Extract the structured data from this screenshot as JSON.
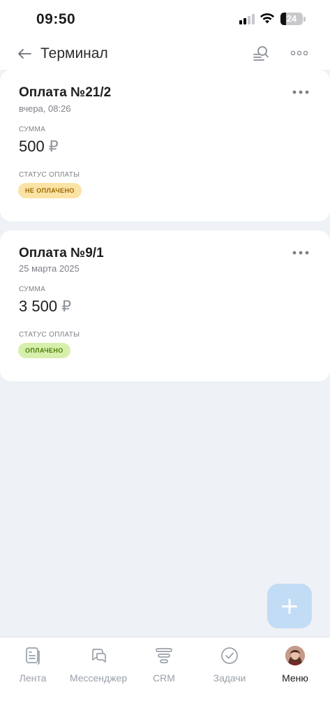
{
  "status_bar": {
    "time": "09:50",
    "battery": "24",
    "battery_level": 0.24
  },
  "header": {
    "title": "Терминал",
    "back_icon": "arrow-left-icon",
    "search_icon": "search-list-icon",
    "more_icon": "more-horizontal-icon"
  },
  "payments": [
    {
      "title": "Оплата №21/2",
      "date": "вчера, 08:26",
      "amount_label": "СУММА",
      "amount": "500",
      "currency": "₽",
      "status_label": "СТАТУС ОПЛАТЫ",
      "status": "НЕ ОПЛАЧЕНО",
      "status_color": "#fbe3a5"
    },
    {
      "title": "Оплата №9/1",
      "date": "25 марта 2025",
      "amount_label": "СУММА",
      "amount": "3 500",
      "currency": "₽",
      "status_label": "СТАТУС ОПЛАТЫ",
      "status": "ОПЛАЧЕНО",
      "status_color": "#d7efac"
    }
  ],
  "fab": {
    "label": "+",
    "color": "#c3dcf5"
  },
  "bottom_nav": [
    {
      "label": "Лента",
      "icon": "feed-icon"
    },
    {
      "label": "Мессенджер",
      "icon": "chat-icon"
    },
    {
      "label": "CRM",
      "icon": "funnel-icon"
    },
    {
      "label": "Задачи",
      "icon": "check-circle-icon"
    },
    {
      "label": "Меню",
      "icon": "avatar",
      "active": true
    }
  ]
}
